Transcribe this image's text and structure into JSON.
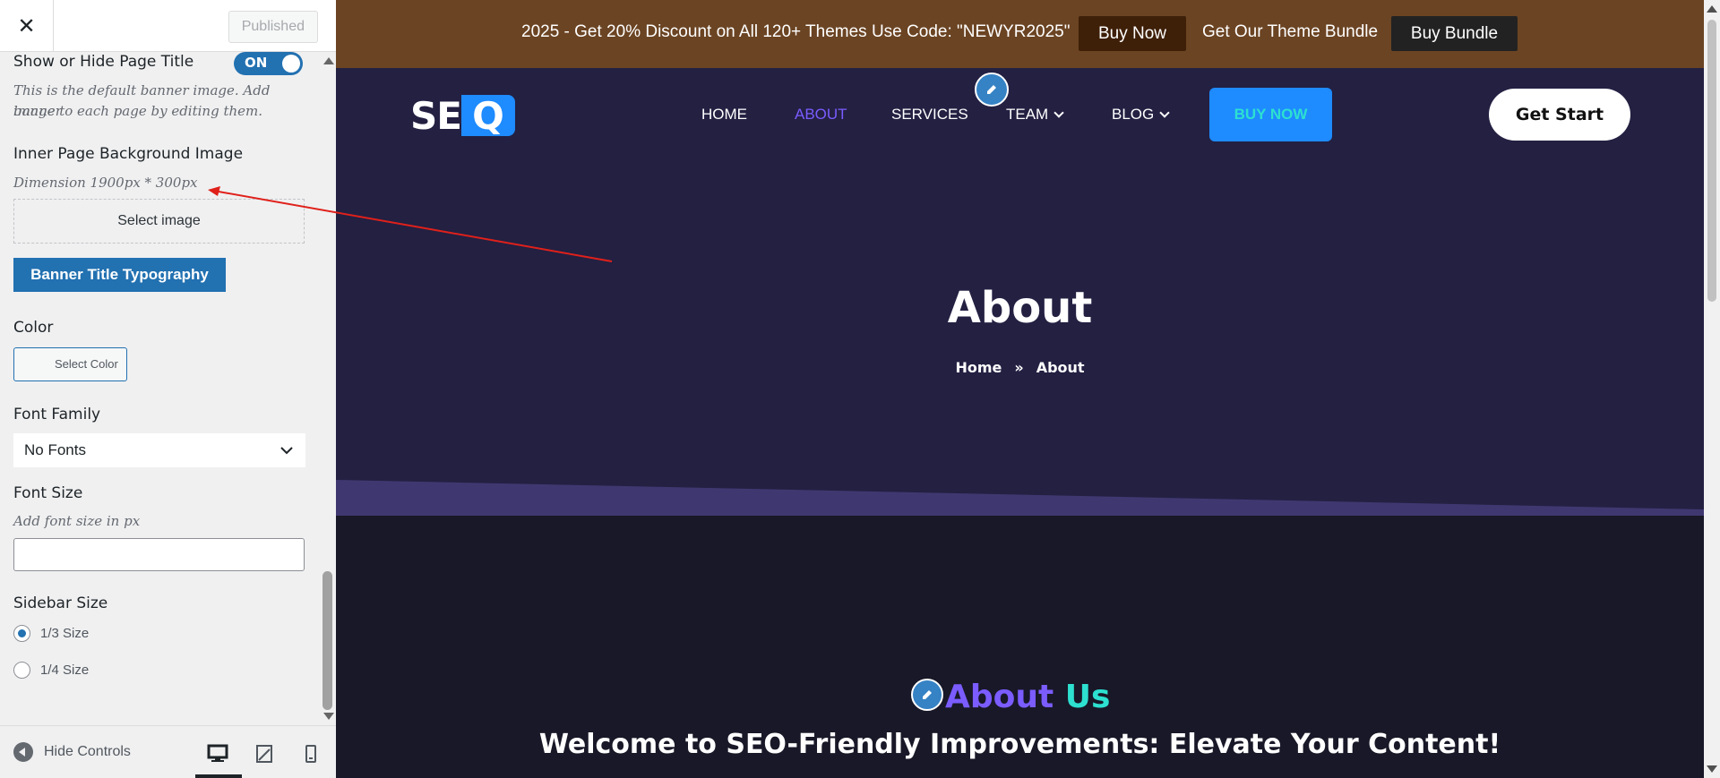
{
  "sidebar": {
    "close_label": "✕",
    "published_label": "Published",
    "show_hide_label": "Show or Hide Page Title",
    "toggle_label": "ON",
    "banner_desc_1": "This is the default banner image. Add banner",
    "banner_desc_2": "image to each page by editing them.",
    "inner_bg_label": "Inner Page Background Image",
    "dimension_label": "Dimension 1900px * 300px",
    "select_image_label": "Select image",
    "typography_button": "Banner Title Typography",
    "color_label": "Color",
    "select_color_label": "Select Color",
    "font_family_label": "Font Family",
    "font_family_value": "No Fonts",
    "font_size_label": "Font Size",
    "font_size_desc": "Add font size in px",
    "sidebar_size_label": "Sidebar Size",
    "radio_1": "1/3 Size",
    "radio_2": "1/4 Size",
    "hide_controls": "Hide Controls"
  },
  "preview": {
    "promo_text": "2025 - Get 20% Discount on All 120+ Themes Use Code: \"NEWYR2025\"",
    "buy_now_top": "Buy Now",
    "bundle_text": "Get Our Theme Bundle",
    "buy_bundle": "Buy Bundle",
    "logo_se": "SE",
    "logo_q": "Q",
    "nav": {
      "home": "HOME",
      "about": "ABOUT",
      "services": "SERVICES",
      "team": "TEAM",
      "blog": "BLOG"
    },
    "buy_now_nav": "BUY NOW",
    "get_start": "Get Start",
    "hero_title": "About",
    "breadcrumb_home": "Home",
    "breadcrumb_sep": "»",
    "breadcrumb_current": "About",
    "about_us_1": "About",
    "about_us_2": "Us",
    "welcome": "Welcome to SEO-Friendly Improvements: Elevate Your Content!"
  },
  "colors": {
    "accent": "#2271b1",
    "topbar": "#6b4423",
    "hero": "#232042",
    "brand_blue": "#1e8bff",
    "purple": "#7b5cff",
    "teal": "#2de0d0",
    "annotation_arrow": "#e0201a"
  }
}
